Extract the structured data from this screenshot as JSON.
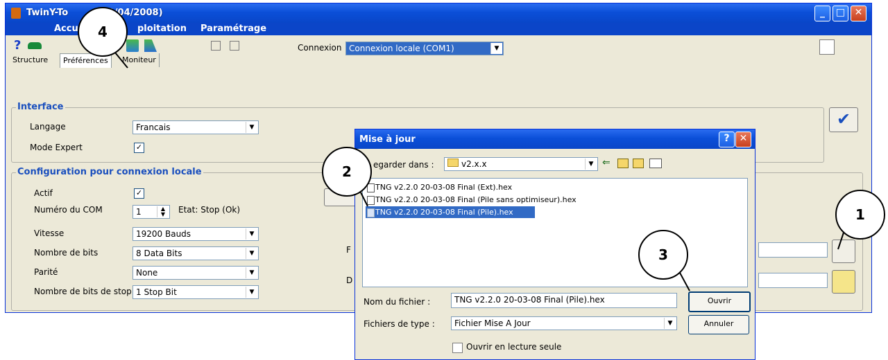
{
  "window": {
    "title": "TwinY-To",
    "title_rest": "(01/04/2008)"
  },
  "menu": {
    "items": [
      "Accueil",
      "ploitation",
      "Paramétrage"
    ]
  },
  "toolbar": {
    "connexion_label": "Connexion",
    "connexion_value": "Connexion locale (COM1)"
  },
  "tabs": [
    "Structure",
    "Préférences",
    "Moniteur"
  ],
  "interface": {
    "legend": "Interface",
    "langage_label": "Langage",
    "langage_value": "Francais",
    "mode_label": "Mode Expert",
    "mode_checked": "✓"
  },
  "config": {
    "legend": "Configuration pour connexion locale",
    "actif_label": "Actif",
    "actif_checked": "✓",
    "com_label": "Numéro du COM",
    "com_value": "1",
    "etat": "Etat: Stop (Ok)",
    "vitesse_label": "Vitesse",
    "vitesse_value": "19200 Bauds",
    "bits_label": "Nombre de bits",
    "bits_value": "8 Data Bits",
    "parite_label": "Parité",
    "parite_value": "None",
    "stop_label": "Nombre de bits de stop",
    "stop_value": "1 Stop Bit",
    "partial_f": "F",
    "partial_d": "D"
  },
  "dialog": {
    "title": "Mise à jour",
    "regarder_label": "egarder dans :",
    "folder": "v2.x.x",
    "files": [
      "TNG v2.2.0 20-03-08 Final (Ext).hex",
      "TNG v2.2.0 20-03-08 Final (Pile sans optimiseur).hex",
      "TNG v2.2.0 20-03-08 Final (Pile).hex"
    ],
    "nom_label": "Nom du fichier :",
    "nom_value": "TNG v2.2.0 20-03-08 Final (Pile).hex",
    "type_label": "Fichiers de type :",
    "type_value": "Fichier Mise A Jour",
    "ouvrir": "Ouvrir",
    "annuler": "Annuler",
    "readonly_label": "Ouvrir en lecture seule"
  },
  "callouts": [
    "4",
    "2",
    "1",
    "3"
  ],
  "colors": {
    "xp_blue": "#0b4fd8",
    "legend_blue": "#1a4fbe",
    "selection": "#316ac5"
  }
}
